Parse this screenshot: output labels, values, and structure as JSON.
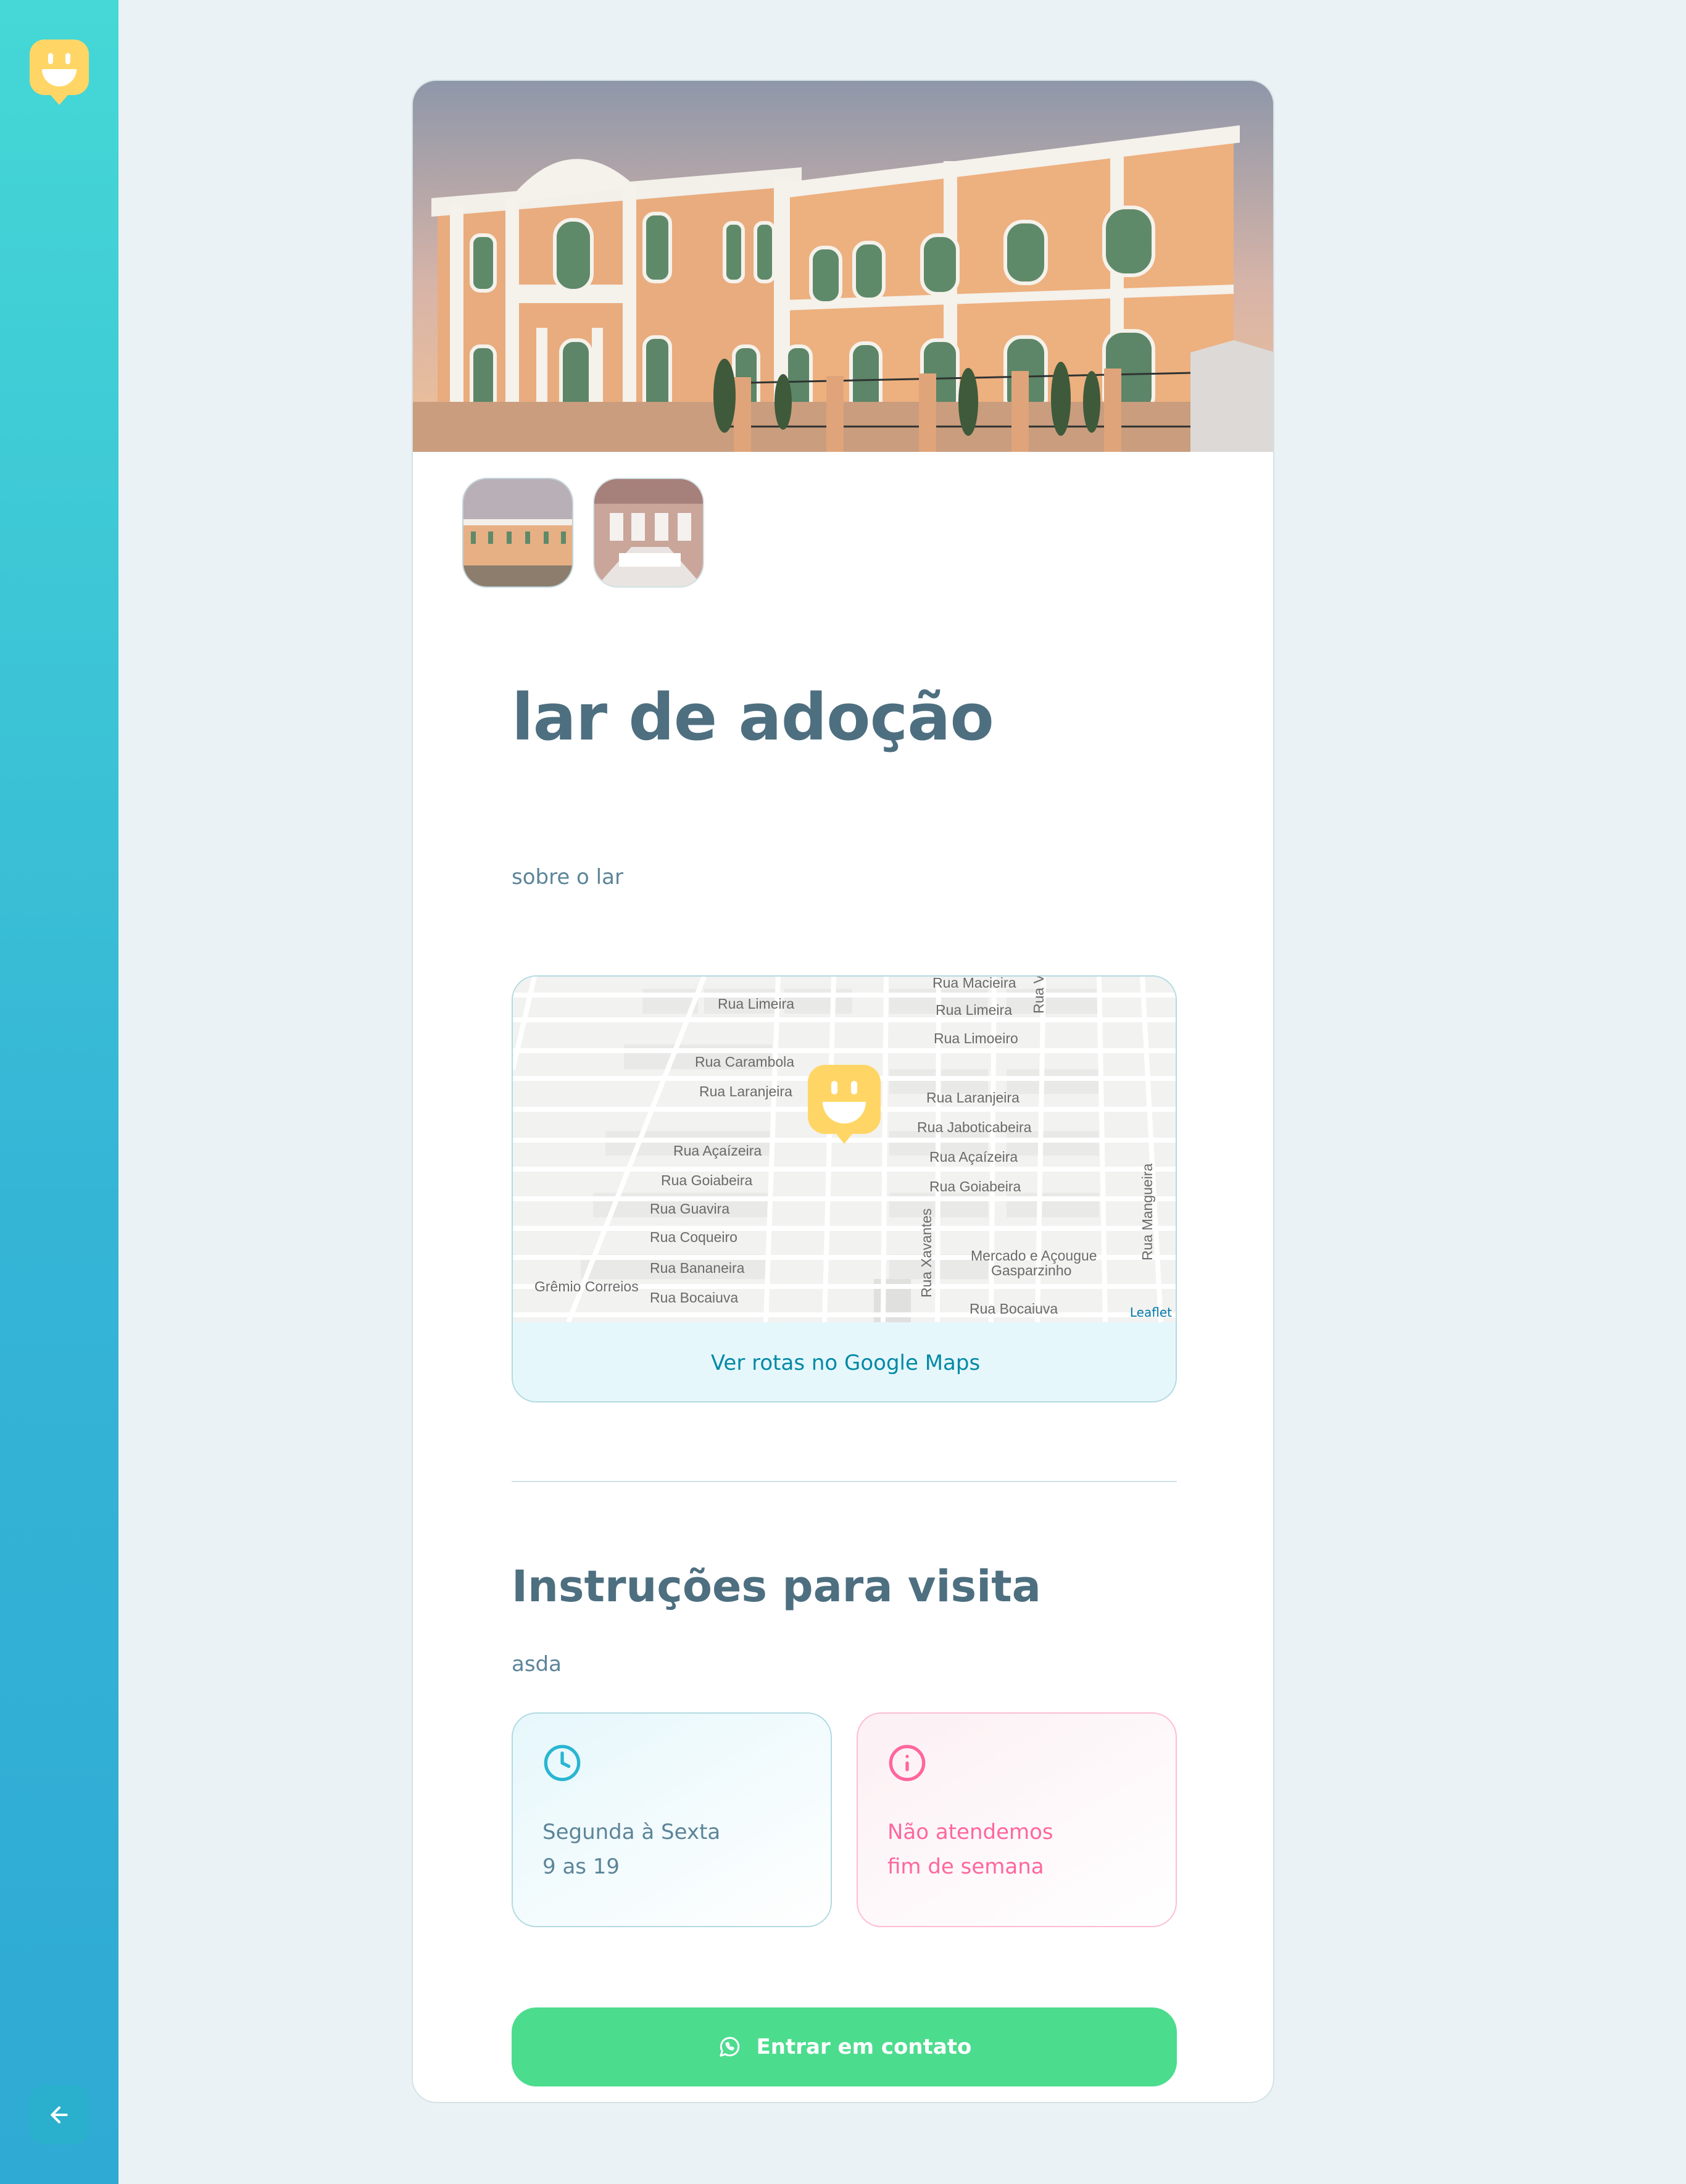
{
  "sidebar": {
    "logo_icon": "happy-marker-icon",
    "back_icon": "arrow-left-icon"
  },
  "gallery": {
    "hero_alt": "orphanage-building-photo",
    "thumbnails": [
      "building-exterior-thumbnail",
      "building-interior-thumbnail"
    ]
  },
  "orphanage": {
    "name": "lar de adoção",
    "about": "sobre o lar"
  },
  "map": {
    "streets": [
      "Rua Macieira",
      "Rua Limeira",
      "Rua Limeira",
      "Rua Limoeiro",
      "Rua Carambola",
      "Rua Laranjeira",
      "Rua Laranjeira",
      "Rua Jaboticabeira",
      "Rua Açaízeira",
      "Rua Açaízeira",
      "Rua Goiabeira",
      "Rua Goiabeira",
      "Rua Guavira",
      "Rua Coqueiro",
      "Rua Bananeira",
      "Rua Bocaiuva",
      "Rua Bocaiuva",
      "Rua Xavantes",
      "Rua Mangueira",
      "Rua Va"
    ],
    "places": [
      "Grêmio Correios",
      "Mercado e Açougue",
      "Gasparzinho"
    ],
    "attribution": "Leaflet",
    "routes_link": "Ver rotas no Google Maps"
  },
  "visit": {
    "title": "Instruções para visita",
    "instructions": "asda",
    "hours_line1": "Segunda à Sexta",
    "hours_line2": "9 as 19",
    "closed_line1": "Não atendemos",
    "closed_line2": "fim de semana",
    "hours_icon": "clock-icon",
    "closed_icon": "info-icon"
  },
  "contact": {
    "label": "Entrar em contato",
    "icon": "whatsapp-icon"
  },
  "colors": {
    "sidebar_top": "#45D8D6",
    "sidebar_bottom": "#2FAAD4",
    "accent_yellow": "#FFD666",
    "contact_green": "#4CDC8E",
    "text_primary": "#4D6F80",
    "pink": "#FF669D"
  }
}
